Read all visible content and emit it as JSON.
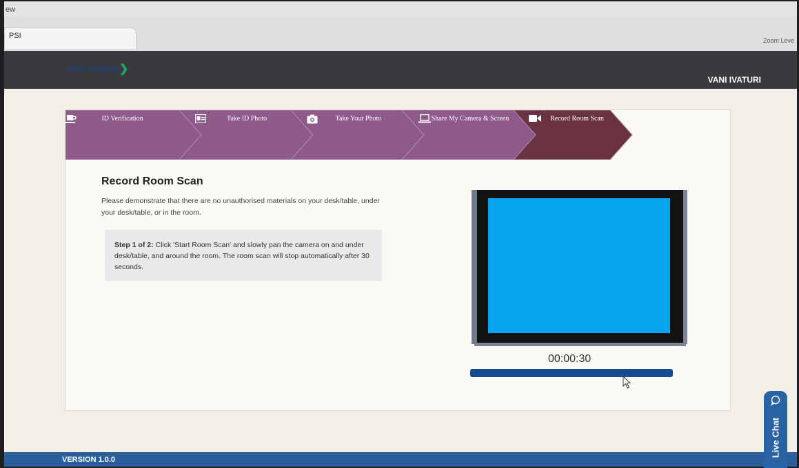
{
  "browser": {
    "menu_fragment": "ew",
    "tab_title": "PSI",
    "zoom_label": "Zoom Leve"
  },
  "header": {
    "logo_text": "PSI Online",
    "user_name": "VANI IVATURI"
  },
  "steps": [
    {
      "label": "ID Verification",
      "icon": "coffee-cup-icon",
      "active": false
    },
    {
      "label": "Take ID Photo",
      "icon": "id-card-icon",
      "active": false
    },
    {
      "label": "Take Your Photo",
      "icon": "camera-icon",
      "active": false
    },
    {
      "label": "Share My Camera & Screen",
      "icon": "laptop-icon",
      "active": false
    },
    {
      "label": "Record Room Scan",
      "icon": "video-camera-icon",
      "active": true
    }
  ],
  "main": {
    "title": "Record Room Scan",
    "description": "Please demonstrate that there are no unauthorised materials on your desk/table, under your desk/table, or in the room.",
    "step_prefix": "Step 1 of 2:",
    "step_text": " Click 'Start Room Scan' and slowly pan the camera on and under desk/table, and around the room. The room scan will stop automatically after 30 seconds.",
    "timer": "00:00:30",
    "progress_fraction": 1.0
  },
  "footer": {
    "version": "VERSION 1.0.0"
  },
  "live_chat": {
    "label": "Live Chat",
    "icon": "chat-bubble-icon"
  },
  "colors": {
    "step_inactive": "#8d5a8a",
    "step_active": "#6b3342",
    "header_bg": "#3a3a3e",
    "footer_bg": "#2a5f9b",
    "video_screen": "#04a5ec",
    "progress_fill": "#164c8e"
  }
}
